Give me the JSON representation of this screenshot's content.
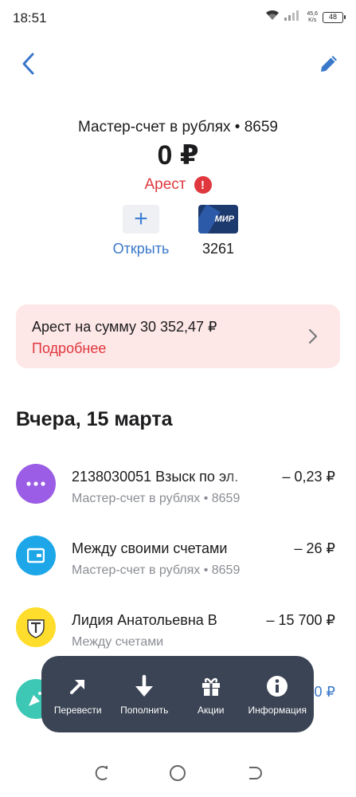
{
  "status_bar": {
    "time": "18:51",
    "net_speed_value": "45,6",
    "net_speed_unit": "K/s",
    "battery": "48"
  },
  "account": {
    "title": "Мастер-счет в рублях • 8659",
    "balance": "0 ₽",
    "status": "Арест",
    "open_label": "Открыть",
    "card_brand": "МИР",
    "card_number": "3261"
  },
  "arrest_banner": {
    "text": "Арест на сумму 30 352,47 ₽",
    "link": "Подробнее"
  },
  "section_title": "Вчера, 15 марта",
  "transactions": [
    {
      "title": "2138030051 Взыск по эл.",
      "subtitle": "Мастер-счет в рублях • 8659",
      "amount": "– 0,23 ₽",
      "avatar_color": "#9b5de5",
      "icon": "more-dots-icon"
    },
    {
      "title": "Между своими счетами",
      "subtitle": "Мастер-счет в рублях • 8659",
      "amount": "– 26 ₽",
      "avatar_color": "#1ea7e8",
      "icon": "wallet-icon"
    },
    {
      "title": "Лидия Анатольевна В",
      "subtitle": "Между счетами",
      "amount": "– 15 700 ₽",
      "avatar_color": "#ffdd2d",
      "icon": "bank-logo-icon"
    },
    {
      "title": "",
      "subtitle": "",
      "amount": "0 ₽",
      "avatar_color": "#3cc8b4",
      "icon": "party-icon"
    }
  ],
  "actions": [
    {
      "label": "Перевести",
      "icon": "arrow-up-right-icon"
    },
    {
      "label": "Пополнить",
      "icon": "arrow-down-icon"
    },
    {
      "label": "Акции",
      "icon": "gift-icon"
    },
    {
      "label": "Информация",
      "icon": "info-icon"
    }
  ],
  "colors": {
    "accent": "#3a78c9",
    "danger": "#e0373e",
    "banner_bg": "#fde7e7",
    "action_bar_bg": "#3b4454"
  }
}
